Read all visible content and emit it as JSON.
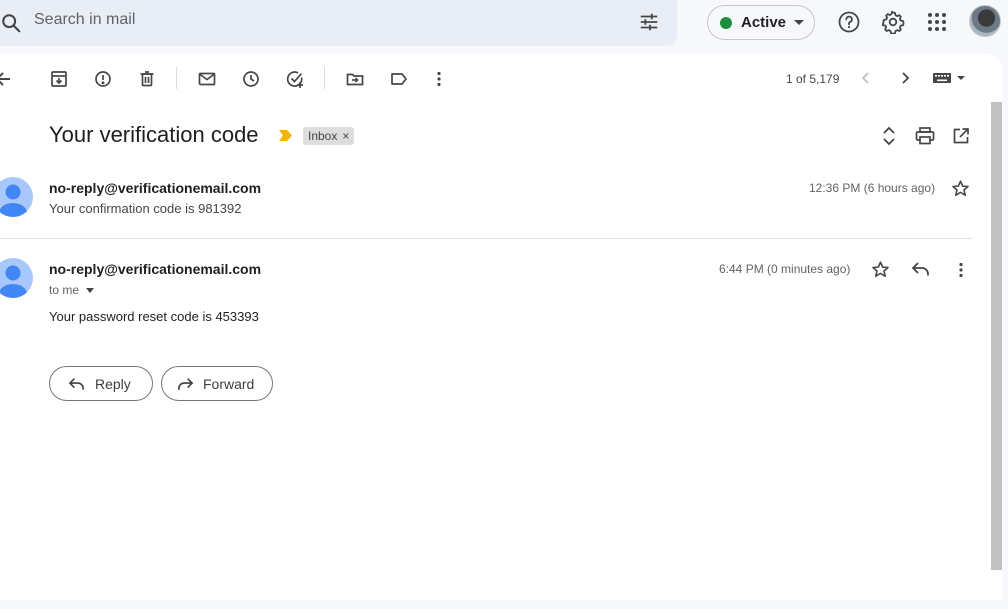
{
  "search": {
    "placeholder": "Search in mail"
  },
  "status": {
    "label": "Active",
    "color": "#1e8e3e"
  },
  "header_icons": [
    "help-icon",
    "settings-icon",
    "apps-icon",
    "avatar"
  ],
  "toolbar": {
    "icons": [
      "back-icon",
      "archive-icon",
      "report-spam-icon",
      "delete-icon",
      "mark-unread-icon",
      "snooze-icon",
      "add-task-icon",
      "move-to-icon",
      "label-icon",
      "more-icon"
    ],
    "pagination": "1 of 5,179"
  },
  "thread": {
    "subject": "Your verification code",
    "label_chip": "Inbox",
    "label_chip_remove": "×"
  },
  "messages": [
    {
      "sender": "no-reply@verificationemail.com",
      "snippet": "Your confirmation code is 981392",
      "time": "12:36 PM (6 hours ago)",
      "collapsed": true
    },
    {
      "sender": "no-reply@verificationemail.com",
      "recipient": "to me",
      "time": "6:44 PM (0 minutes ago)",
      "body": "Your password reset code is 453393",
      "collapsed": false
    }
  ],
  "actions": {
    "reply": "Reply",
    "forward": "Forward"
  },
  "colors": {
    "accent_blue": "#4285f4",
    "important_marker": "#f4b400",
    "avatar_bg": "#a8c7fa"
  }
}
